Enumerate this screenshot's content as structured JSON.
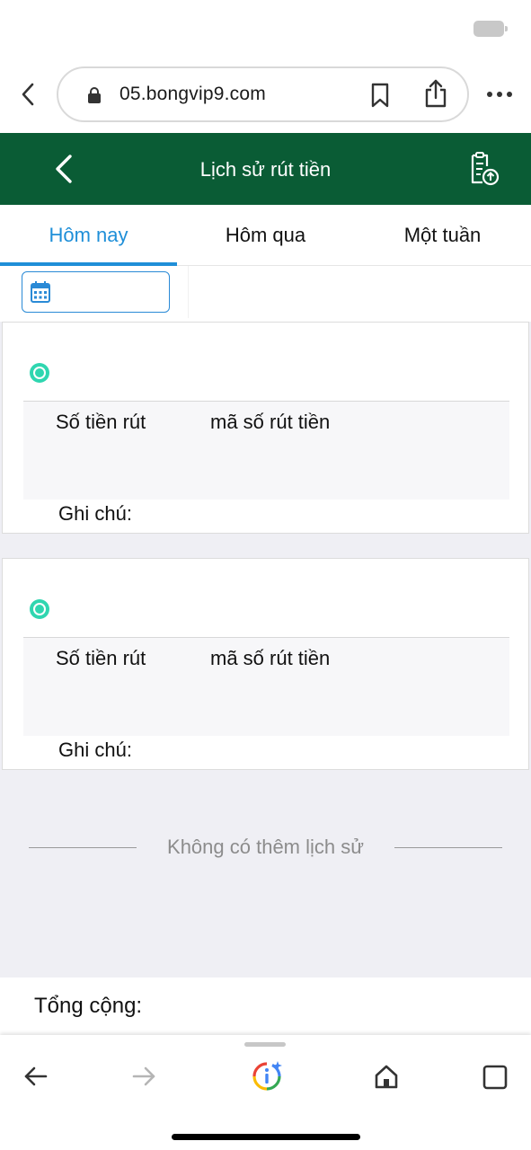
{
  "browser": {
    "url": "05.bongvip9.com"
  },
  "header": {
    "title": "Lịch sử rút tiền"
  },
  "tabs": [
    {
      "label": "Hôm nay",
      "active": true
    },
    {
      "label": "Hôm qua",
      "active": false
    },
    {
      "label": "Một tuần",
      "active": false
    }
  ],
  "records": [
    {
      "amount_label": "Số tiền rút",
      "code_label": "mã số rút tiền",
      "note_label": "Ghi chú:"
    },
    {
      "amount_label": "Số tiền rút",
      "code_label": "mã số rút tiền",
      "note_label": "Ghi chú:"
    }
  ],
  "list_end_text": "Không có thêm lịch sử",
  "total": {
    "label": "Tổng cộng:"
  },
  "icons": {
    "back": "chevron-left-icon",
    "lock": "lock-icon",
    "bookmark": "bookmark-icon",
    "share": "share-icon",
    "more": "more-icon",
    "export": "clipboard-upload-icon",
    "calendar": "calendar-icon",
    "status": "status-check-icon",
    "forward": "arrow-right-icon",
    "assistant": "google-assistant-icon",
    "home": "home-icon",
    "tabs": "tabs-icon"
  },
  "colors": {
    "header_bg": "#0a5c35",
    "tab_active": "#1f8fd8",
    "status_dot": "#2fd6b0",
    "list_bg": "#efeff4"
  }
}
